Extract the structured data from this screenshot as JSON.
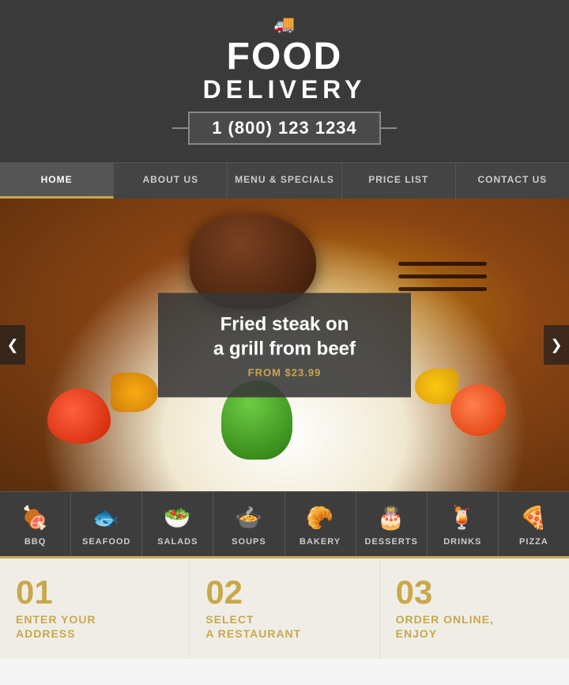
{
  "header": {
    "truck_icon": "🚚",
    "title_food": "FOOD",
    "title_delivery": "DELIVERY",
    "phone": "1 (800) 123 1234"
  },
  "nav": {
    "items": [
      {
        "label": "HOME",
        "active": true
      },
      {
        "label": "ABOUT US",
        "active": false
      },
      {
        "label": "MENU & SPECIALS",
        "active": false
      },
      {
        "label": "PRICE LIST",
        "active": false
      },
      {
        "label": "CONTACT US",
        "active": false
      }
    ]
  },
  "hero": {
    "dish_name": "Fried steak on\na grill from beef",
    "price_label": "FROM $23.99",
    "arrow_left": "❮",
    "arrow_right": "❯"
  },
  "categories": [
    {
      "label": "BBQ",
      "icon": "🍖"
    },
    {
      "label": "SEAFOOD",
      "icon": "🐟"
    },
    {
      "label": "SALADS",
      "icon": "🥗"
    },
    {
      "label": "SOUPS",
      "icon": "🍲"
    },
    {
      "label": "BAKERY",
      "icon": "🥐"
    },
    {
      "label": "DESSERTS",
      "icon": "🎂"
    },
    {
      "label": "DRINKS",
      "icon": "🍹"
    },
    {
      "label": "PIZZA",
      "icon": "🍕"
    }
  ],
  "steps": [
    {
      "number": "01",
      "title": "ENTER YOUR\nADDRESS"
    },
    {
      "number": "02",
      "title": "SELECT\nA RESTAURANT"
    },
    {
      "number": "03",
      "title": "ORDER ONLINE,\nENJOY"
    }
  ]
}
